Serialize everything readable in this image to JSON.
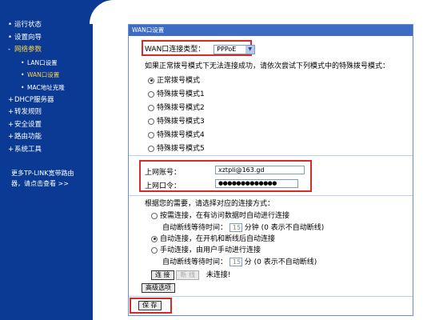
{
  "sidebar": {
    "items": [
      {
        "label": "运行状态",
        "bullet": "•"
      },
      {
        "label": "设置向导",
        "bullet": "•"
      },
      {
        "label": "网络参数",
        "bullet": "-"
      },
      {
        "label": "LAN口设置",
        "bullet": "•"
      },
      {
        "label": "WAN口设置",
        "bullet": "•"
      },
      {
        "label": "MAC地址克隆",
        "bullet": "•"
      },
      {
        "label": "DHCP服务器",
        "bullet": "+"
      },
      {
        "label": "转发规则",
        "bullet": "+"
      },
      {
        "label": "安全设置",
        "bullet": "+"
      },
      {
        "label": "路由功能",
        "bullet": "+"
      },
      {
        "label": "系统工具",
        "bullet": "+"
      }
    ],
    "promo_line1": "更多TP-LINK宽带路由",
    "promo_line2": "器，请点击查看 >>"
  },
  "panel": {
    "title": "WAN口设置",
    "conn_type_label": "WAN口连接类型：",
    "conn_type_value": "PPPoE",
    "hint": "如果正常拨号模式下无法连接成功，请依次尝试下列模式中的特殊拨号模式：",
    "dial_modes": [
      "正常拨号模式",
      "特殊拨号模式1",
      "特殊拨号模式2",
      "特殊拨号模式3",
      "特殊拨号模式4",
      "特殊拨号模式5"
    ],
    "account_label": "上网账号：",
    "account_value": "xztpli@163.gd",
    "password_label": "上网口令：",
    "password_value": "●●●●●●●●●●●●●",
    "conn_mode_hint": "根据您的需要，请选择对应的连接方式：",
    "on_demand": "按需连接，在有访问数据时自动进行连接",
    "idle_label": "自动断线等待时间：",
    "idle_value": "15",
    "idle_unit": "分钟 (0 表示不自动断线)",
    "auto_connect": "自动连接，在开机和断线后自动连接",
    "manual_connect": "手动连接，由用户手动进行连接",
    "idle_label2": "自动断线等待时间：",
    "idle_value2": "15",
    "idle_unit2": "分 (0 表示不自动断线)",
    "connect_btn": "连 接",
    "disconnect_btn": "断 线",
    "status": "未连接!",
    "advanced_btn": "高级选项",
    "save_btn": "保 存"
  }
}
